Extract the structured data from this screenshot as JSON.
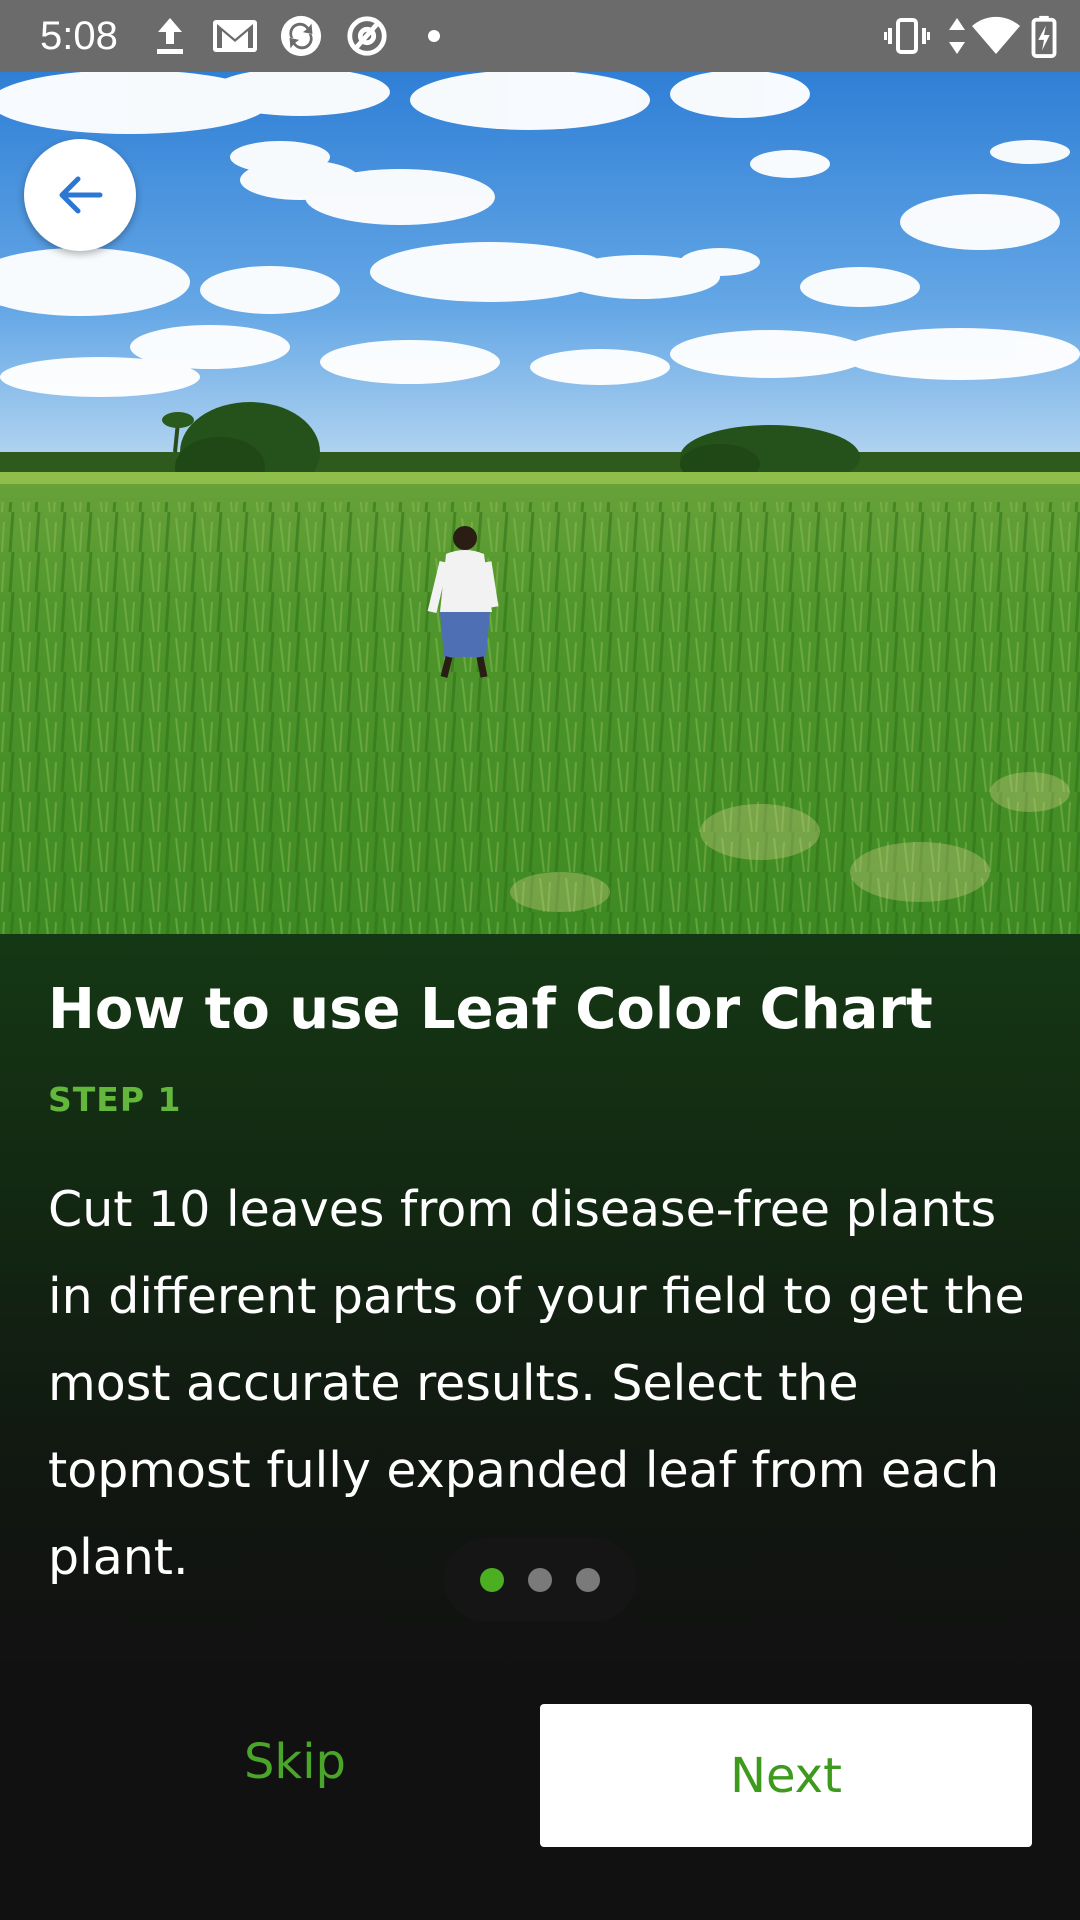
{
  "status_bar": {
    "time": "5:08",
    "icons": [
      "upload-icon",
      "gmail-icon",
      "sync-icon",
      "at-sign-icon",
      "dot-icon",
      "vibrate-icon",
      "data-arrows-icon",
      "wifi-icon",
      "battery-charging-icon"
    ]
  },
  "hero": {
    "image": "rice-paddy-field-with-farmer-photo",
    "back_icon": "arrow-back-icon"
  },
  "content": {
    "title": "How to use Leaf Color Chart",
    "step_label": "STEP 1",
    "description": "Cut 10 leaves from disease-free plants in different parts of your field to get the most accurate results. Select the topmost fully expanded leaf from each plant."
  },
  "pager": {
    "count": 3,
    "active_index": 0,
    "active_color": "#4caf22",
    "inactive_color": "#7a7a7a"
  },
  "actions": {
    "skip_label": "Skip",
    "next_label": "Next"
  },
  "colors": {
    "accent": "#4aa628",
    "panel_top": "#153814",
    "background": "#111111",
    "status_bar": "#6b6b6b"
  }
}
